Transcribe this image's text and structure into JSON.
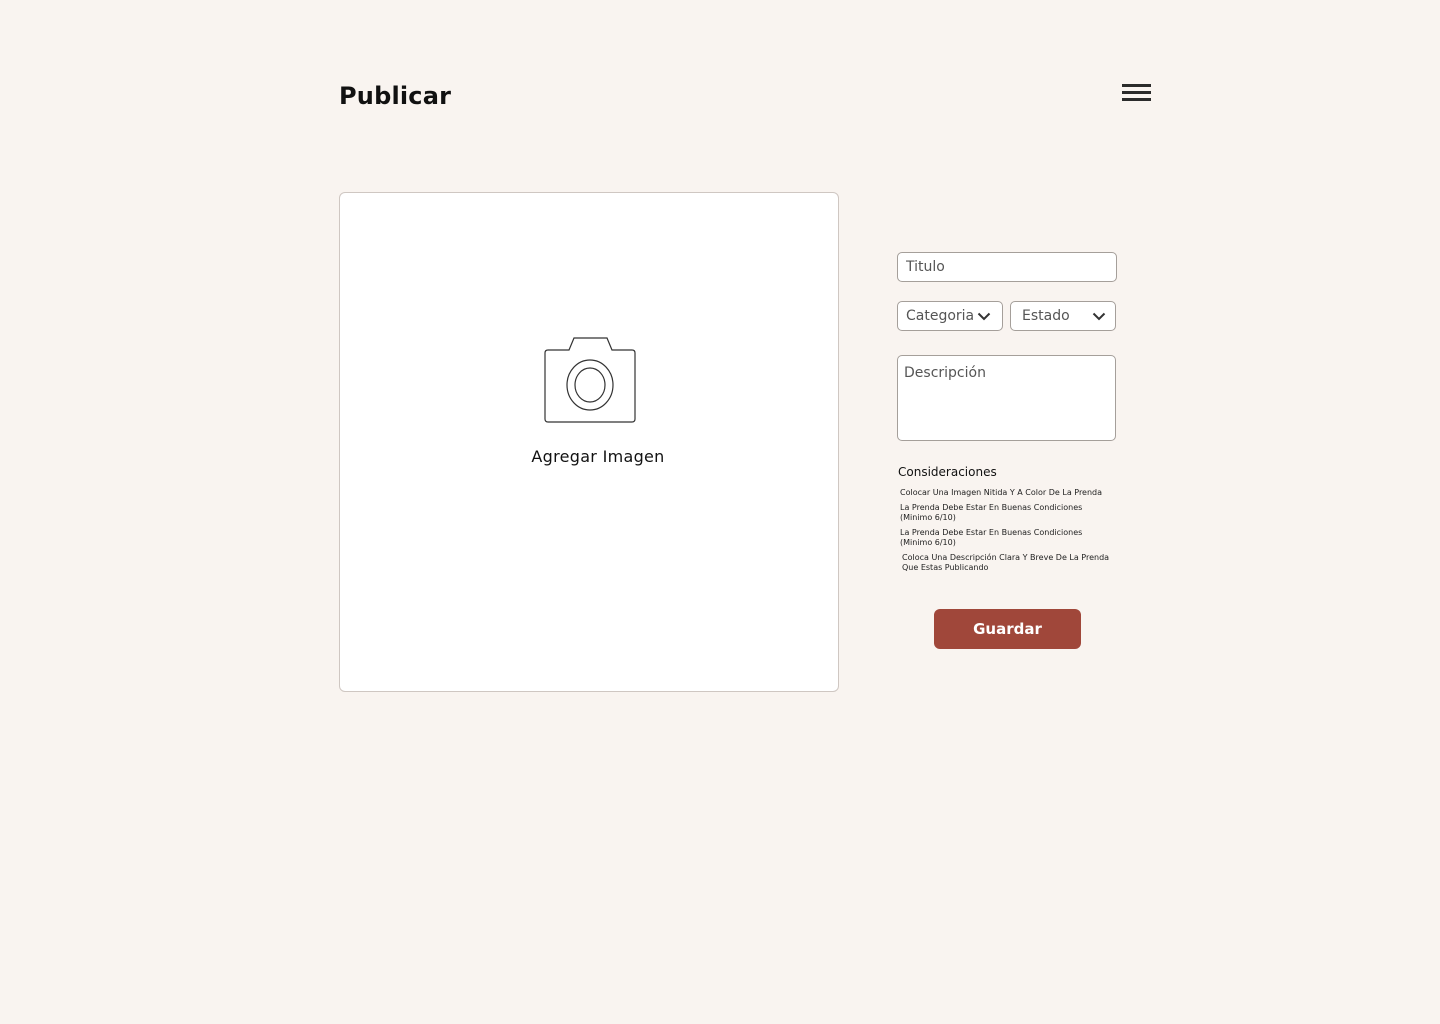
{
  "header": {
    "title": "Publicar",
    "menu_icon": "hamburger-menu-icon"
  },
  "image_upload": {
    "icon": "camera-icon",
    "label": "Agregar Imagen"
  },
  "form": {
    "title_placeholder": "Titulo",
    "category_label": "Categoria",
    "state_label": "Estado",
    "description_placeholder": "Descripción",
    "dropdown_icon": "chevron-down-icon"
  },
  "considerations": {
    "title": "Consideraciones",
    "items": [
      "Colocar Una Imagen Nitida Y A Color De La Prenda",
      "La Prenda Debe Estar En Buenas Condiciones (Minimo 6/10)",
      "La Prenda Debe Estar En Buenas Condiciones (Minimo 6/10)",
      "Coloca Una Descripción Clara Y Breve De La Prenda Que Estas Publicando"
    ]
  },
  "save_label": "Guardar",
  "colors": {
    "background": "#f9f4f0",
    "accent": "#a0473a",
    "border": "#a59f9a"
  }
}
